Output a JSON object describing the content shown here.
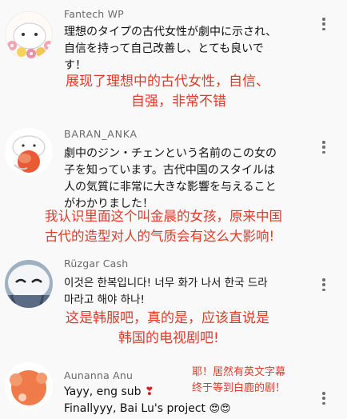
{
  "comments": [
    {
      "username": "Fantech WP",
      "text_lines": [
        "理想のタイプの古代女性が劇中に示され、",
        "自信を持って自己改善し、とても良いで",
        "す！"
      ],
      "overlay_lines": [
        "展现了理想中的古代女性，自信、",
        "自强，非常不错"
      ]
    },
    {
      "username": "BARAN_ANKA",
      "text_lines": [
        "劇中のジン・チェンという名前のこの女の",
        "子を知っています。古代中国のスタイルは",
        "人の気質に非常に大きな影響を与えること",
        "がわかりました！"
      ],
      "overlay_lines": [
        "我认识里面这个叫金晨的女孩，原来中国",
        "古代的造型对人的气质会有这么大影响!"
      ]
    },
    {
      "username": "Rüzgar Cash",
      "text_lines": [
        "이것은 한복입니다! 너무 화가 나서 한국 드라",
        "마라고 해야 하나!"
      ],
      "overlay_lines": [
        "这是韩服吧，真的是，应该直说是",
        "韩国的电视剧吧!"
      ]
    },
    {
      "username": "Aunanna Anu",
      "text_lines": [
        "Yayy, eng sub",
        "Finallyyy, Bai Lu's project"
      ],
      "heart": "❣",
      "emojis": "😍😍",
      "overlay_lines": [
        "耶！居然有英文字幕",
        "终于等到白鹿的剧！"
      ]
    }
  ],
  "icons": {
    "more_menu": "kebab-menu-icon"
  },
  "colors": {
    "background": "#f9f9f9",
    "overlay_text": "#e03a2a",
    "username": "#6a6a6a"
  }
}
